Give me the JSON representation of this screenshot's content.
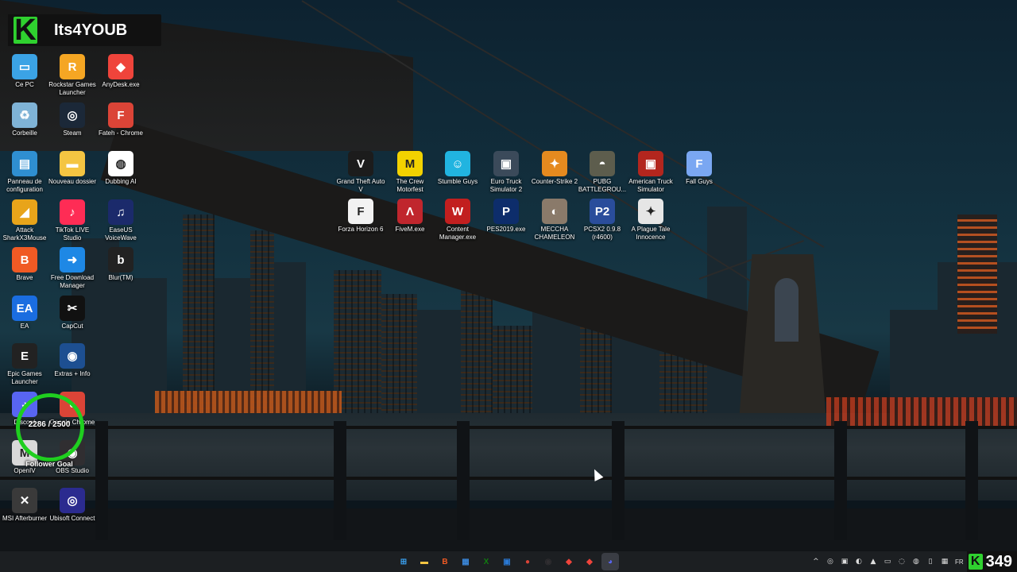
{
  "brand": {
    "logo_letter": "K",
    "name": "Its4YOUB"
  },
  "desktop_icons": [
    {
      "label": "Ce PC",
      "icon": "monitor-icon",
      "color": "#3ba3e5"
    },
    {
      "label": "Corbeille",
      "icon": "recycle-bin-icon",
      "color": "#7fb3d6"
    },
    {
      "label": "Panneau de configuration",
      "icon": "control-panel-icon",
      "color": "#2f8fd1"
    },
    {
      "label": "Attack SharkX3Mouse",
      "icon": "shark-icon",
      "color": "#e8a41a"
    },
    {
      "label": "Brave",
      "icon": "brave-icon",
      "color": "#f05a24"
    },
    {
      "label": "EA",
      "icon": "ea-icon",
      "color": "#1a6de0"
    },
    {
      "label": "Epic Games Launcher",
      "icon": "epic-games-icon",
      "color": "#222222"
    },
    {
      "label": "Discord",
      "icon": "discord-icon",
      "color": "#5865f2"
    },
    {
      "label": "OpenIV",
      "icon": "openiv-icon",
      "color": "#d9d9d9"
    },
    {
      "label": "MSI Afterburner",
      "icon": "msi-afterburner-icon",
      "color": "#3a3a3a"
    },
    {
      "label": "Rockstar Games Launcher",
      "icon": "rockstar-icon",
      "color": "#f5a623"
    },
    {
      "label": "Steam",
      "icon": "steam-icon",
      "color": "#1b2838"
    },
    {
      "label": "Nouveau dossier",
      "icon": "folder-icon",
      "color": "#f4c542"
    },
    {
      "label": "TikTok LIVE Studio",
      "icon": "tiktok-icon",
      "color": "#fe2c55"
    },
    {
      "label": "Free Download Manager",
      "icon": "fdm-icon",
      "color": "#1e88e5"
    },
    {
      "label": "CapCut",
      "icon": "capcut-icon",
      "color": "#111111"
    },
    {
      "label": "Extras + Info",
      "icon": "extras-icon",
      "color": "#1d4f91"
    },
    {
      "label": "Google Chrome",
      "icon": "chrome-icon",
      "color": "#db4437"
    },
    {
      "label": "OBS Studio",
      "icon": "obs-icon",
      "color": "#302e31"
    },
    {
      "label": "Ubisoft Connect",
      "icon": "ubisoft-icon",
      "color": "#2b2b8f"
    },
    {
      "label": "AnyDesk.exe",
      "icon": "anydesk-icon",
      "color": "#ef443b"
    },
    {
      "label": "Fateh - Chrome",
      "icon": "chrome-profile-icon",
      "color": "#db4437"
    },
    {
      "label": "Dubbing AI",
      "icon": "dubbing-ai-icon",
      "color": "#ffffff"
    },
    {
      "label": "EaseUS VoiceWave",
      "icon": "voicewave-icon",
      "color": "#1b2a6b"
    },
    {
      "label": "Blur(TM)",
      "icon": "blur-icon",
      "color": "#222222"
    },
    {
      "label": "Grand Theft Auto V",
      "icon": "gta-icon",
      "color": "#1c1c1c"
    },
    {
      "label": "The Crew Motorfest",
      "icon": "crew-motorfest-icon",
      "color": "#f2d200"
    },
    {
      "label": "Stumble Guys",
      "icon": "stumble-guys-icon",
      "color": "#21b4e0"
    },
    {
      "label": "Euro Truck Simulator 2",
      "icon": "euro-truck-icon",
      "color": "#3b4a5a"
    },
    {
      "label": "Counter-Strike 2",
      "icon": "cs2-icon",
      "color": "#e58a1f"
    },
    {
      "label": "PUBG BATTLEGROU...",
      "icon": "pubg-icon",
      "color": "#5d5d4d"
    },
    {
      "label": "American Truck Simulator",
      "icon": "american-truck-icon",
      "color": "#b3261e"
    },
    {
      "label": "Fall Guys",
      "icon": "fall-guys-icon",
      "color": "#7aa7f2"
    },
    {
      "label": "Forza Horizon 6",
      "icon": "forza-icon",
      "color": "#f2f2f2"
    },
    {
      "label": "FiveM.exe",
      "icon": "fivem-icon",
      "color": "#c0262d"
    },
    {
      "label": "Content Manager.exe",
      "icon": "content-manager-icon",
      "color": "#c21f1f"
    },
    {
      "label": "PES2019.exe",
      "icon": "pes-icon",
      "color": "#0d2d6b"
    },
    {
      "label": "MECCHA CHAMELEON",
      "icon": "chameleon-icon",
      "color": "#8a7a6a"
    },
    {
      "label": "PCSX2 0.9.8 (r4600)",
      "icon": "pcsx2-icon",
      "color": "#2a4d9b"
    },
    {
      "label": "A Plague Tale Innocence",
      "icon": "plague-tale-icon",
      "color": "#e6e6e6"
    }
  ],
  "follower_goal": {
    "count": "2286 / 2500",
    "caption": "Follower Goal",
    "color": "#1fcf1f"
  },
  "taskbar": {
    "apps": [
      {
        "icon": "start-icon",
        "glyph": "⊞",
        "color": "#3aa0f0"
      },
      {
        "icon": "file-explorer-icon",
        "glyph": "▬",
        "color": "#f4c542"
      },
      {
        "icon": "brave-icon",
        "glyph": "B",
        "color": "#f05a24"
      },
      {
        "icon": "store-icon",
        "glyph": "▦",
        "color": "#3a86d8"
      },
      {
        "icon": "xbox-icon",
        "glyph": "X",
        "color": "#107c10"
      },
      {
        "icon": "photos-icon",
        "glyph": "▣",
        "color": "#2a7ad6"
      },
      {
        "icon": "chrome-icon",
        "glyph": "●",
        "color": "#db4437"
      },
      {
        "icon": "obs-icon",
        "glyph": "◉",
        "color": "#302e31"
      },
      {
        "icon": "anydesk-icon",
        "glyph": "◆",
        "color": "#ef443b"
      },
      {
        "icon": "anydesk-icon-2",
        "glyph": "◆",
        "color": "#ef443b"
      },
      {
        "icon": "discord-icon",
        "glyph": "◕",
        "color": "#5865f2"
      }
    ],
    "tray": {
      "icons": [
        "^",
        "◎",
        "▣",
        "◐",
        "▲",
        "▭",
        "◌",
        "◍",
        "▯",
        "▦"
      ],
      "language": "FR",
      "sub_logo": "K",
      "sub_count": "349"
    }
  }
}
